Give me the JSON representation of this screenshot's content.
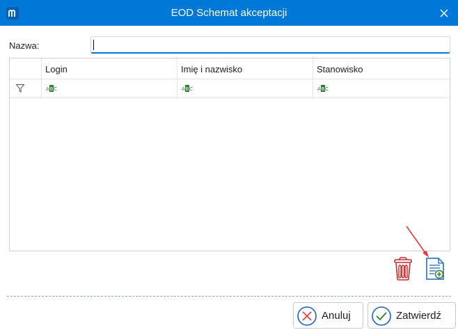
{
  "window": {
    "title": "EOD Schemat akceptacji"
  },
  "form": {
    "name_label": "Nazwa:",
    "name_value": ""
  },
  "grid": {
    "columns": [
      "Login",
      "Imię i nazwisko",
      "Stanowisko"
    ],
    "filter_icon": "funnel-icon",
    "filter_cell_icon": "abc-text-filter-icon",
    "rows": []
  },
  "toolbar": {
    "delete_icon": "trash-icon",
    "add_icon": "add-document-icon"
  },
  "footer": {
    "cancel_label": "Anuluj",
    "confirm_label": "Zatwierdź"
  },
  "colors": {
    "titlebar": "#0078d7",
    "icon_red": "#c62828",
    "icon_blue": "#1565c0",
    "icon_green": "#2e7d32",
    "annotation_arrow": "#e53935"
  }
}
